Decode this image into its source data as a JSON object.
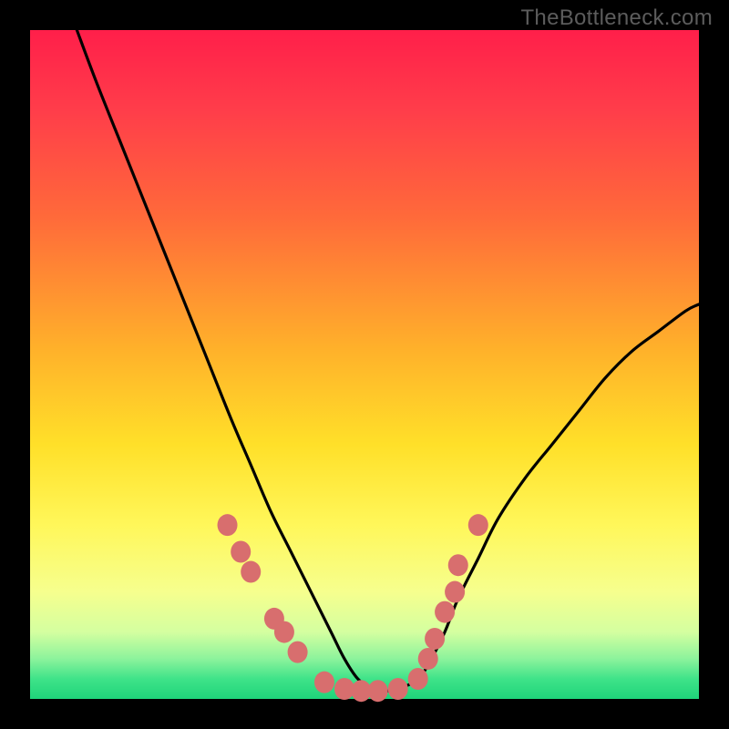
{
  "attribution": "TheBottleneck.com",
  "colors": {
    "frame": "#000000",
    "curve_stroke": "#000000",
    "marker_fill": "#d86e6e",
    "gradient_stops": [
      "#ff1f4a",
      "#ff3d4a",
      "#ff6a3a",
      "#ffb22a",
      "#ffe029",
      "#fff75a",
      "#f6ff8e",
      "#d4ffa0",
      "#8cf39c",
      "#3fe389",
      "#1fd47a"
    ]
  },
  "chart_data": {
    "type": "line",
    "title": "",
    "xlabel": "",
    "ylabel": "",
    "xlim": [
      0,
      100
    ],
    "ylim": [
      0,
      100
    ],
    "series": [
      {
        "name": "bottleneck-curve",
        "x": [
          7,
          10,
          14,
          18,
          22,
          26,
          30,
          33,
          36,
          39,
          42,
          45,
          47,
          49,
          51,
          53,
          55,
          58,
          60,
          62,
          64,
          67,
          70,
          74,
          78,
          82,
          86,
          90,
          94,
          98,
          100
        ],
        "y": [
          100,
          92,
          82,
          72,
          62,
          52,
          42,
          35,
          28,
          22,
          16,
          10,
          6,
          3,
          1.5,
          1.2,
          1.5,
          3,
          6,
          10,
          15,
          21,
          27,
          33,
          38,
          43,
          48,
          52,
          55,
          58,
          59
        ]
      }
    ],
    "markers": {
      "name": "left-and-right-rim-dots",
      "points": [
        {
          "x": 29.5,
          "y": 26
        },
        {
          "x": 31.5,
          "y": 22
        },
        {
          "x": 33.0,
          "y": 19
        },
        {
          "x": 36.5,
          "y": 12
        },
        {
          "x": 38.0,
          "y": 10
        },
        {
          "x": 40.0,
          "y": 7
        },
        {
          "x": 44.0,
          "y": 2.5
        },
        {
          "x": 47.0,
          "y": 1.5
        },
        {
          "x": 49.5,
          "y": 1.2
        },
        {
          "x": 52.0,
          "y": 1.2
        },
        {
          "x": 55.0,
          "y": 1.5
        },
        {
          "x": 58.0,
          "y": 3.0
        },
        {
          "x": 59.5,
          "y": 6
        },
        {
          "x": 60.5,
          "y": 9
        },
        {
          "x": 62.0,
          "y": 13
        },
        {
          "x": 63.5,
          "y": 16
        },
        {
          "x": 64.0,
          "y": 20
        },
        {
          "x": 67.0,
          "y": 26
        }
      ]
    }
  }
}
